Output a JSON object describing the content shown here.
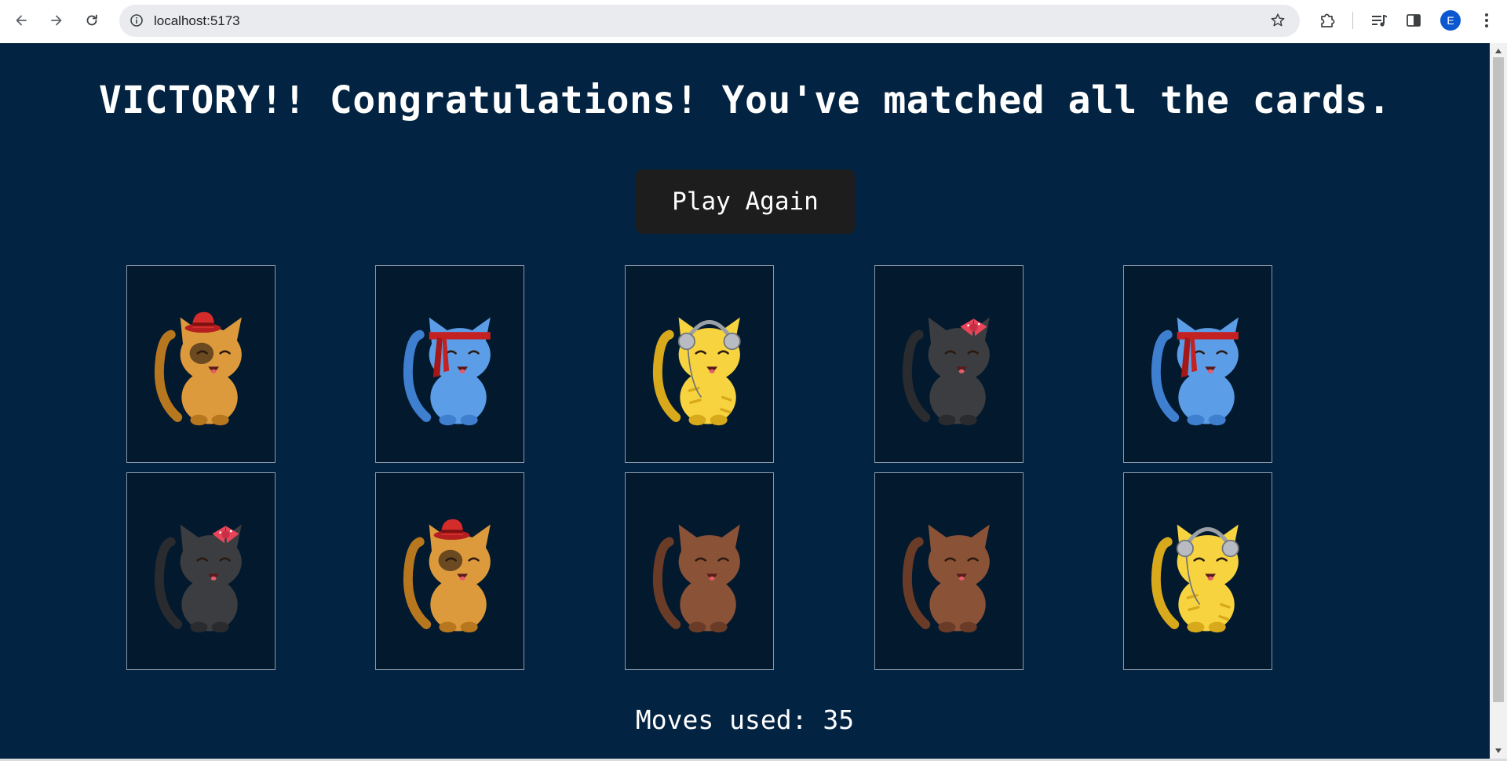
{
  "browser": {
    "url": "localhost:5173",
    "profile_initial": "E",
    "icons": {
      "back": "arrow-left-icon",
      "forward": "arrow-right-icon",
      "reload": "reload-icon",
      "site_info": "info-icon",
      "bookmark": "star-icon",
      "extensions": "puzzle-icon",
      "media": "media-queue-icon",
      "side_panel": "side-panel-icon",
      "menu": "kebab-menu-icon"
    }
  },
  "game": {
    "headline": "VICTORY!! Congratulations! You've matched all the cards.",
    "play_again_label": "Play Again",
    "moves_label": "Moves used:",
    "moves_value": "35",
    "cards": [
      {
        "cat": "orange-cat-red-hat"
      },
      {
        "cat": "blue-cat-red-headband"
      },
      {
        "cat": "yellow-tiger-cat-headphones"
      },
      {
        "cat": "gray-cat-pink-bow"
      },
      {
        "cat": "blue-cat-red-headband"
      },
      {
        "cat": "gray-cat-pink-bow"
      },
      {
        "cat": "orange-cat-red-hat"
      },
      {
        "cat": "brown-cat"
      },
      {
        "cat": "brown-cat"
      },
      {
        "cat": "yellow-tiger-cat-headphones"
      }
    ]
  },
  "colors": {
    "page_background": "#022341",
    "card_background": "#03192e",
    "button_background": "#1d1d1d",
    "text": "#ffffff"
  }
}
